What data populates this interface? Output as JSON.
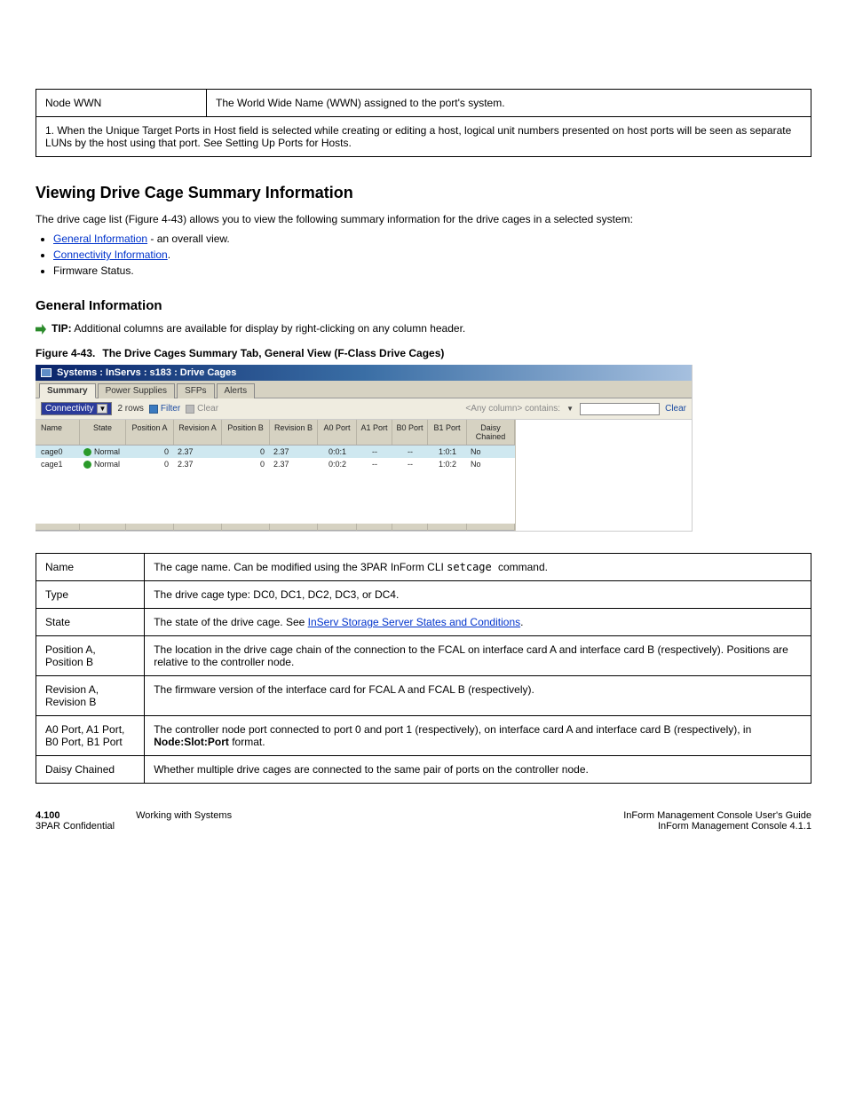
{
  "top_table": {
    "left": "Node WWN",
    "right": "The World Wide Name (WWN) assigned to the port's system.",
    "bottom": "1. When the Unique Target Ports in Host field is selected while creating or editing a host, logical unit numbers presented on host ports will be seen as separate LUNs by the host using that port. See Setting Up Ports for Hosts."
  },
  "section": {
    "title": "Viewing Drive Cage Summary Information",
    "intro": "The drive cage list (Figure 4-43) allows you to view the following summary information for the drive cages in a selected system:",
    "bullets": [
      {
        "label": "General Information",
        "text": " - an overall view.",
        "link": true
      },
      {
        "label": "Connectivity Information",
        "text": ".",
        "link": true
      },
      {
        "label": "Firmware Status.",
        "text": "",
        "link": false
      }
    ]
  },
  "subsection_title": "General Information",
  "tip": {
    "label": "TIP:",
    "text": "Additional columns are available for display by right-clicking on any column header."
  },
  "figure": {
    "index": "Figure 4-43.",
    "caption": "The Drive Cages Summary Tab, General View (F-Class Drive Cages)"
  },
  "screenshot": {
    "title": "Systems : InServs : s183 : Drive Cages",
    "tabs": [
      "Summary",
      "Power Supplies",
      "SFPs",
      "Alerts"
    ],
    "active_tab": 0,
    "dropdown": "Connectivity",
    "rows_label": "2 rows",
    "filter_label": "Filter",
    "clear_left_label": "Clear",
    "anycol": "<Any column> contains:",
    "clear_link": "Clear",
    "search_placeholder": "",
    "columns": [
      "Name",
      "State",
      "Position A",
      "Revision A",
      "Position B",
      "Revision B",
      "A0 Port",
      "A1 Port",
      "B0 Port",
      "B1 Port",
      "Daisy Chained"
    ],
    "data_rows": [
      {
        "name": "cage0",
        "state": "Normal",
        "posA": "0",
        "revA": "2.37",
        "posB": "0",
        "revB": "2.37",
        "a0": "0:0:1",
        "a1": "--",
        "b0": "--",
        "b1": "1:0:1",
        "daisy": "No"
      },
      {
        "name": "cage1",
        "state": "Normal",
        "posA": "0",
        "revA": "2.37",
        "posB": "0",
        "revB": "2.37",
        "a0": "0:0:2",
        "a1": "--",
        "b0": "--",
        "b1": "1:0:2",
        "daisy": "No"
      }
    ]
  },
  "def_table": [
    {
      "label": "Name",
      "desc_parts": [
        {
          "t": "The cage name. Can be modified using the ",
          "link": false
        },
        {
          "t": "3PAR InForm CLI ",
          "link": false,
          "bold": true
        },
        {
          "t": "setcage ",
          "link": false,
          "code": true
        },
        {
          "t": "command.",
          "link": false
        }
      ]
    },
    {
      "label": "Type",
      "desc_parts": [
        {
          "t": "The drive cage type: DC0, DC1, DC2, DC3, or DC4.",
          "link": false
        }
      ]
    },
    {
      "label": "State",
      "desc_parts": [
        {
          "t": "The state of the drive cage. See ",
          "link": false
        },
        {
          "t": "InServ Storage Server States and Conditions",
          "link": true
        },
        {
          "t": ".",
          "link": false
        }
      ]
    },
    {
      "label": "Position A, Position B",
      "desc_parts": [
        {
          "t": "The location in the drive cage chain of the connection to the FCAL on interface card A and interface card B (respectively). Positions are relative to the controller node.",
          "link": false
        }
      ]
    },
    {
      "label": "Revision A, Revision B",
      "desc_parts": [
        {
          "t": "The firmware version of the interface card for FCAL A and FCAL B (respectively).",
          "link": false
        }
      ]
    },
    {
      "label": "A0 Port, A1 Port, B0 Port, B1 Port",
      "desc_parts": [
        {
          "t": "The controller node port connected to port 0 and port 1 (respectively), on interface card A and interface card B (respectively), in ",
          "link": false
        },
        {
          "t": "Node:Slot:Port",
          "link": false,
          "bold": true
        },
        {
          "t": " format.",
          "link": false
        }
      ]
    },
    {
      "label": "Daisy Chained",
      "desc_parts": [
        {
          "t": "Whether multiple drive cages are connected to the same pair of ports on the controller node.",
          "link": false
        }
      ]
    }
  ],
  "footer": {
    "chapter": "4.100",
    "chap_label": "Working with Systems",
    "manual": "InForm Management Console User's Guide",
    "rev": "3PAR Confidential",
    "date": "InForm Management Console 4.1.1"
  }
}
